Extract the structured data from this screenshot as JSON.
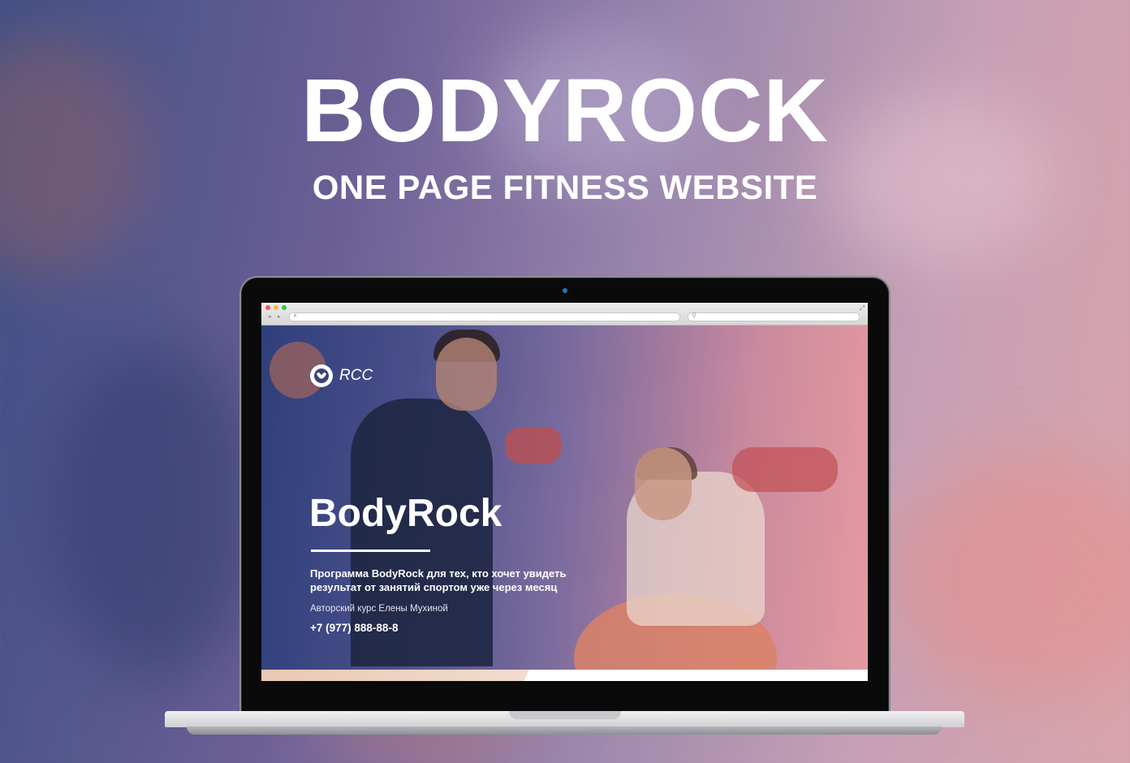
{
  "headline": {
    "title": "BODYROCK",
    "subtitle": "ONE PAGE FITNESS WEBSITE"
  },
  "browser": {
    "nav_back": "◂",
    "nav_forward": "▸",
    "add_tab": "+",
    "search_icon": "search-icon",
    "fullscreen_icon": "fullscreen-icon"
  },
  "site": {
    "logo_text": "RCC",
    "title": "BodyRock",
    "description": "Программа BodyRock для тех, кто хочет увидеть результат от занятий спортом уже через месяц",
    "author": "Авторский курс Елены Мухиной",
    "phone": "+7 (977) 888-88-8"
  },
  "colors": {
    "accent_pink": "#e49aa0",
    "accent_blue": "#2f3f7a",
    "text": "#ffffff"
  }
}
